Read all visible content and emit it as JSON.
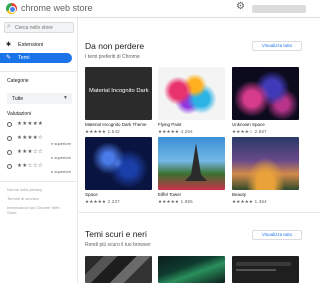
{
  "header": {
    "title": "chrome web store"
  },
  "sidebar": {
    "search_placeholder": "Cerca nello store",
    "nav": [
      {
        "label": "Estensioni",
        "icon": "puzzle-icon"
      },
      {
        "label": "Temi",
        "icon": "brush-icon",
        "selected": true
      }
    ],
    "categories_label": "Categorie",
    "category_selected": "Tutte",
    "ratings_label": "Valutazioni",
    "ratings": [
      {
        "stars": "★★★★★",
        "suffix": ""
      },
      {
        "stars": "★★★★☆",
        "suffix": "e superiore"
      },
      {
        "stars": "★★★☆☆",
        "suffix": "e superiore"
      },
      {
        "stars": "★★☆☆☆",
        "suffix": "e superiore"
      }
    ],
    "footer_links": [
      "Norme sulla privacy",
      "Termini di servizio",
      "Informazioni sul Chrome Web Store"
    ]
  },
  "sections": [
    {
      "title": "Da non perdere",
      "subtitle": "I temi preferiti di Chrome",
      "view_all": "Visualizza tutto",
      "items": [
        {
          "name": "Material Incognito Dark Theme",
          "stars": "★★★★★",
          "count": "1.542",
          "overlay": "Material Incognito Dark"
        },
        {
          "name": "Flying Paint",
          "stars": "★★★★★",
          "count": "4.264",
          "overlay": ""
        },
        {
          "name": "Unknown Space",
          "stars": "★★★★☆",
          "count": "2.567",
          "overlay": ""
        },
        {
          "name": "Space",
          "stars": "★★★★★",
          "count": "2.237",
          "overlay": ""
        },
        {
          "name": "Eiffel Tower",
          "stars": "★★★★★",
          "count": "1.955",
          "overlay": ""
        },
        {
          "name": "Beauty",
          "stars": "★★★★★",
          "count": "1.364",
          "overlay": ""
        }
      ]
    },
    {
      "title": "Temi scuri e neri",
      "subtitle": "Rendi più scuro il tuo browser",
      "view_all": "Visualizza tutto"
    }
  ]
}
